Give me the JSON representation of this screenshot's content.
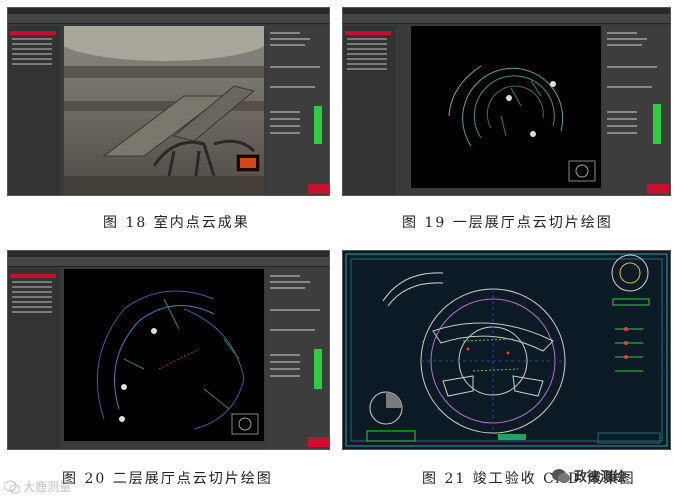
{
  "captions": {
    "fig18": "图 18  室内点云成果",
    "fig19": "图 19  一层展厅点云切片绘图",
    "fig20": "图 20  二层展厅点云切片绘图",
    "fig21": "图 21  竣工验收 CAD 成果图"
  },
  "watermarks": {
    "right": "政徕测绘",
    "left": "大鹿测量"
  },
  "colors": {
    "app_bg": "#3a3a3a",
    "viewport_bg": "#000000",
    "accent_red": "#c8102e",
    "status_green": "#2ecc40",
    "cad_bg": "#0b1a24"
  }
}
